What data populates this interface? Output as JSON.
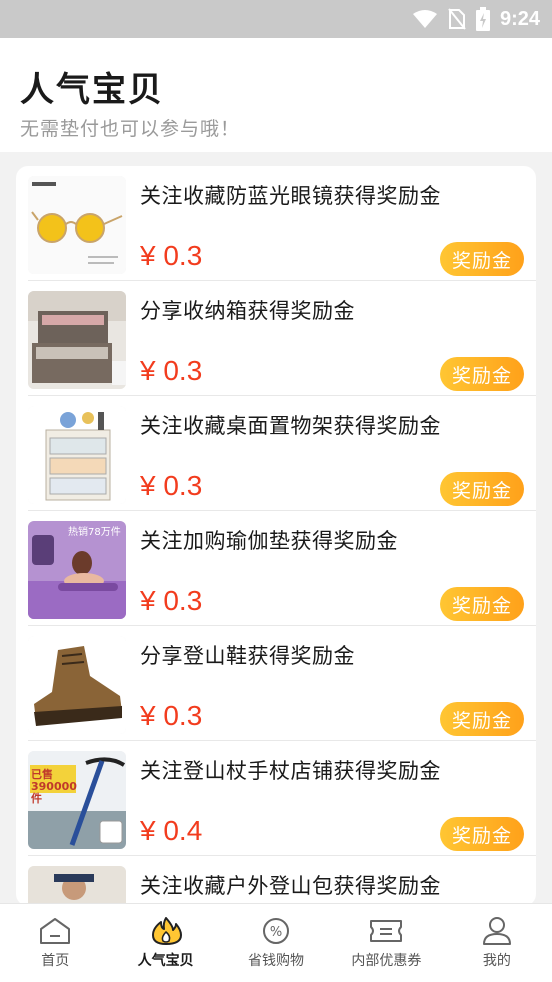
{
  "status": {
    "time": "9:24"
  },
  "header": {
    "title": "人气宝贝",
    "subtitle": "无需垫付也可以参与哦！"
  },
  "items": [
    {
      "title": "关注收藏防蓝光眼镜获得奖励金",
      "price": "¥ 0.3",
      "button": "奖励金",
      "image": "glasses"
    },
    {
      "title": "分享收纳箱获得奖励金",
      "price": "¥ 0.3",
      "button": "奖励金",
      "image": "storage-box"
    },
    {
      "title": "关注收藏桌面置物架获得奖励金",
      "price": "¥ 0.3",
      "button": "奖励金",
      "image": "desk-rack"
    },
    {
      "title": "关注加购瑜伽垫获得奖励金",
      "price": "¥ 0.3",
      "button": "奖励金",
      "image": "yoga-mat",
      "overlay": "热销78万件"
    },
    {
      "title": "分享登山鞋获得奖励金",
      "price": "¥ 0.3",
      "button": "奖励金",
      "image": "hiking-boot"
    },
    {
      "title": "关注登山杖手杖店铺获得奖励金",
      "price": "¥ 0.4",
      "button": "奖励金",
      "image": "trekking-pole",
      "overlay": "已售 390000件"
    },
    {
      "title": "关注收藏户外登山包获得奖励金",
      "price": "",
      "button": "",
      "image": "backpack"
    }
  ],
  "tabs": [
    {
      "label": "首页",
      "icon": "home-icon"
    },
    {
      "label": "人气宝贝",
      "icon": "fire-icon",
      "active": true
    },
    {
      "label": "省钱购物",
      "icon": "discount-icon"
    },
    {
      "label": "内部优惠券",
      "icon": "coupon-icon"
    },
    {
      "label": "我的",
      "icon": "user-icon"
    }
  ],
  "colors": {
    "price": "#f23c1e",
    "button_start": "#ffc633",
    "button_end": "#ffa11a"
  }
}
